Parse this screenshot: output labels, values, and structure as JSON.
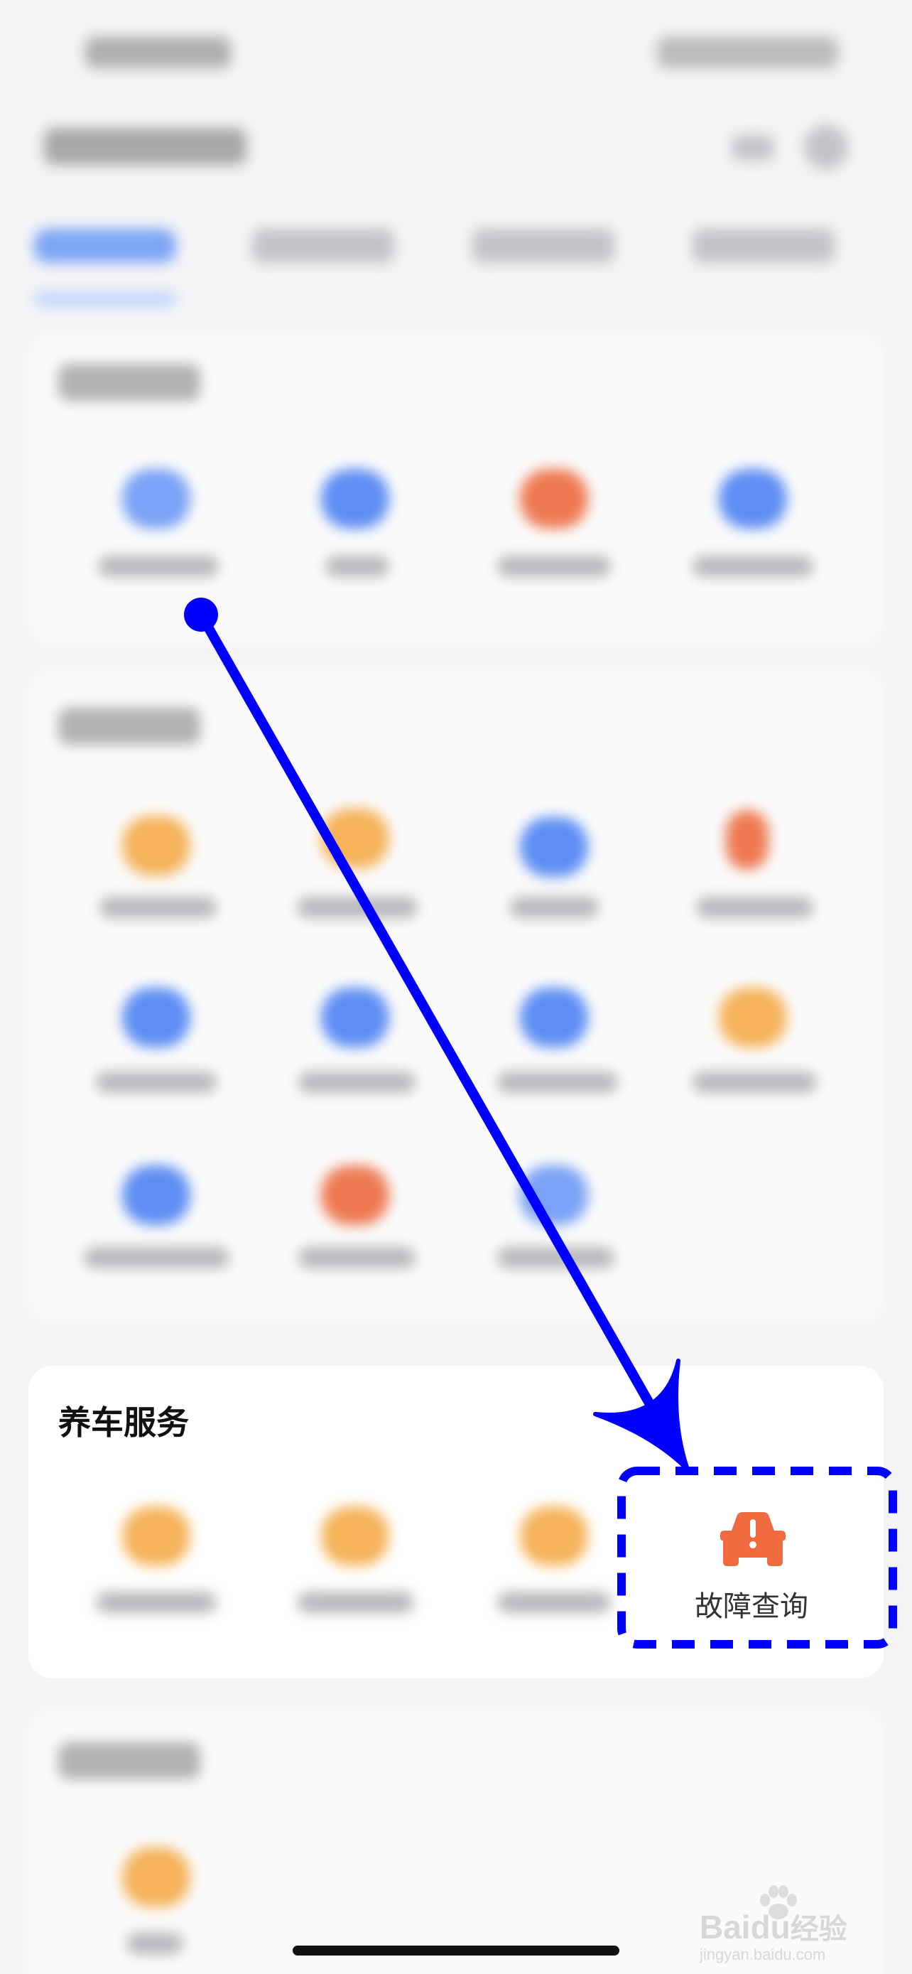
{
  "service_section": {
    "title": "养车服务",
    "highlighted_item": {
      "label": "故障查询",
      "icon": "car-warning-icon",
      "icon_color": "#ef6b3f"
    }
  },
  "annotation": {
    "arrow_color": "#0000ff",
    "highlight_border_color": "#0000ff"
  },
  "watermark": {
    "brand": "Baidu",
    "text": "经验",
    "sub": "jingyan.baidu.com"
  }
}
